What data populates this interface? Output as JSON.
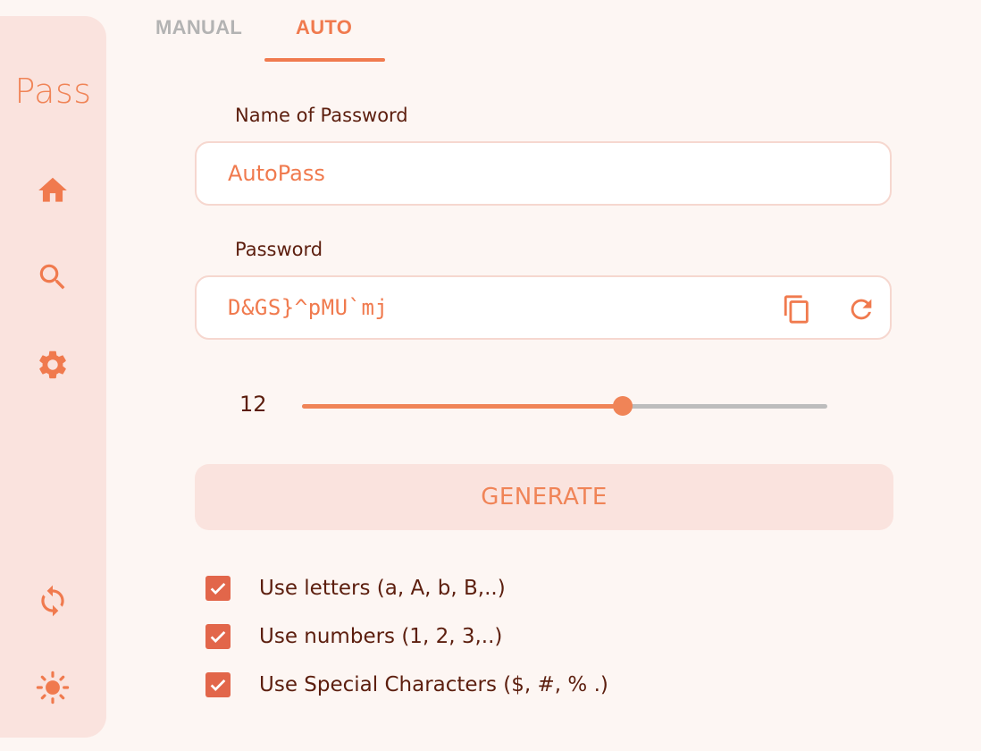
{
  "app": {
    "title": "Pass"
  },
  "sidebar": {
    "icons": [
      "home-icon",
      "search-icon",
      "settings-icon",
      "sync-icon",
      "theme-sun-icon"
    ]
  },
  "tabs": [
    {
      "label": "MANUAL",
      "active": false
    },
    {
      "label": "AUTO",
      "active": true
    }
  ],
  "form": {
    "name_label": "Name of Password",
    "name_value": "AutoPass",
    "password_label": "Password",
    "password_value": "D&GS}^pMU`mj",
    "length": 12,
    "length_fraction": 0.61,
    "generate_label": "GENERATE"
  },
  "options": [
    {
      "label": "Use letters (a, A, b, B,..)",
      "checked": true
    },
    {
      "label": "Use numbers (1, 2, 3,..)",
      "checked": true
    },
    {
      "label": "Use Special Characters ($, #, % .)",
      "checked": true
    }
  ],
  "colors": {
    "accent": "#f07a4e",
    "sidebar_bg": "#fae3de",
    "background": "#fdf6f3",
    "text_dark": "#5c1e0e",
    "checkbox": "#e2664a"
  }
}
